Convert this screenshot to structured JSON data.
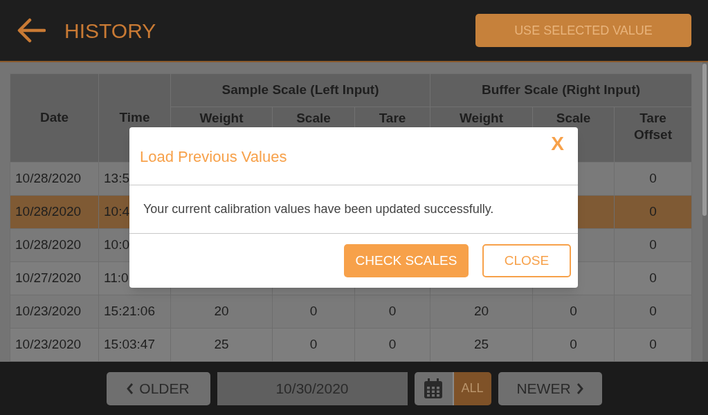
{
  "header": {
    "title": "HISTORY",
    "action_button": "USE SELECTED VALUE"
  },
  "table": {
    "columns": [
      {
        "label": "Date"
      },
      {
        "label": "Time"
      }
    ],
    "groups": [
      {
        "label": "Sample Scale (Left Input)",
        "subcolumns": [
          "Weight",
          "Scale",
          "Tare"
        ]
      },
      {
        "label": "Buffer Scale (Right Input)",
        "subcolumns": [
          "Weight",
          "Scale",
          "Tare Offset"
        ]
      }
    ],
    "rows": [
      {
        "date": "10/28/2020",
        "time": "13:5",
        "last": "0",
        "selected": false
      },
      {
        "date": "10/28/2020",
        "time": "10:4",
        "last": "0",
        "selected": true
      },
      {
        "date": "10/28/2020",
        "time": "10:0",
        "last": "0",
        "selected": false
      },
      {
        "date": "10/27/2020",
        "time": "11:0",
        "last": "0",
        "selected": false
      },
      {
        "date": "10/23/2020",
        "time": "15:21:06",
        "middle": [
          "20",
          "0",
          "0",
          "20",
          "0"
        ],
        "last": "0",
        "selected": false
      },
      {
        "date": "10/23/2020",
        "time": "15:03:47",
        "middle": [
          "25",
          "0",
          "0",
          "25",
          "0"
        ],
        "last": "0",
        "selected": false
      }
    ]
  },
  "footer": {
    "older": "OLDER",
    "date": "10/30/2020",
    "all": {
      "label": "ALL",
      "selected": true
    },
    "newer": "NEWER"
  },
  "dialog": {
    "title": "Load Previous Values",
    "close_mark": "X",
    "message": "Your current calibration values have been updated successfully.",
    "buttons": [
      {
        "label": "CHECK SCALES",
        "kind": "primary"
      },
      {
        "label": "CLOSE",
        "kind": "outline"
      }
    ]
  }
}
